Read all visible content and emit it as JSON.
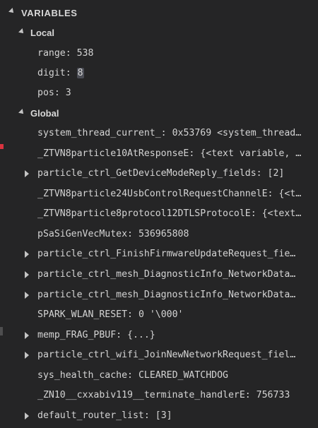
{
  "panel": {
    "title": "VARIABLES"
  },
  "local": {
    "label": "Local",
    "items": [
      {
        "name": "range",
        "value": "538"
      },
      {
        "name": "digit",
        "value": "8"
      },
      {
        "name": "pos",
        "value": "3"
      }
    ]
  },
  "global": {
    "label": "Global",
    "items": [
      {
        "name": "system_thread_current_",
        "value": "0x53769 <system_thread…"
      },
      {
        "name": "_ZTVN8particle10AtResponseE",
        "value": "{<text variable, …"
      },
      {
        "name": "particle_ctrl_GetDeviceModeReply_fields",
        "value": "[2]"
      },
      {
        "name": "_ZTVN8particle24UsbControlRequestChannelE",
        "value": "{<t…"
      },
      {
        "name": "_ZTVN8particle8protocol12DTLSProtocolE",
        "value": "{<text…"
      },
      {
        "name": "pSaSiGenVecMutex",
        "value": "536965808"
      },
      {
        "name": "particle_ctrl_FinishFirmwareUpdateRequest_fie…",
        "value": ""
      },
      {
        "name": "particle_ctrl_mesh_DiagnosticInfo_NetworkData…",
        "value": ""
      },
      {
        "name": "particle_ctrl_mesh_DiagnosticInfo_NetworkData…",
        "value": ""
      },
      {
        "name": "SPARK_WLAN_RESET",
        "value": "0 '\\000'"
      },
      {
        "name": "memp_FRAG_PBUF",
        "value": "{...}"
      },
      {
        "name": "particle_ctrl_wifi_JoinNewNetworkRequest_fiel…",
        "value": ""
      },
      {
        "name": "sys_health_cache",
        "value": "CLEARED_WATCHDOG"
      },
      {
        "name": "_ZN10__cxxabiv119__terminate_handlerE",
        "value": "756733"
      },
      {
        "name": "default_router_list",
        "value": "[3]"
      }
    ]
  },
  "colors": {
    "background": "#252526",
    "text": "#d4d4d4",
    "breakpoint_marker": "#d9333f",
    "highlight": "#4b4d55"
  },
  "icons": {
    "expanded": "chevron-down-icon",
    "collapsed": "chevron-right-icon"
  }
}
